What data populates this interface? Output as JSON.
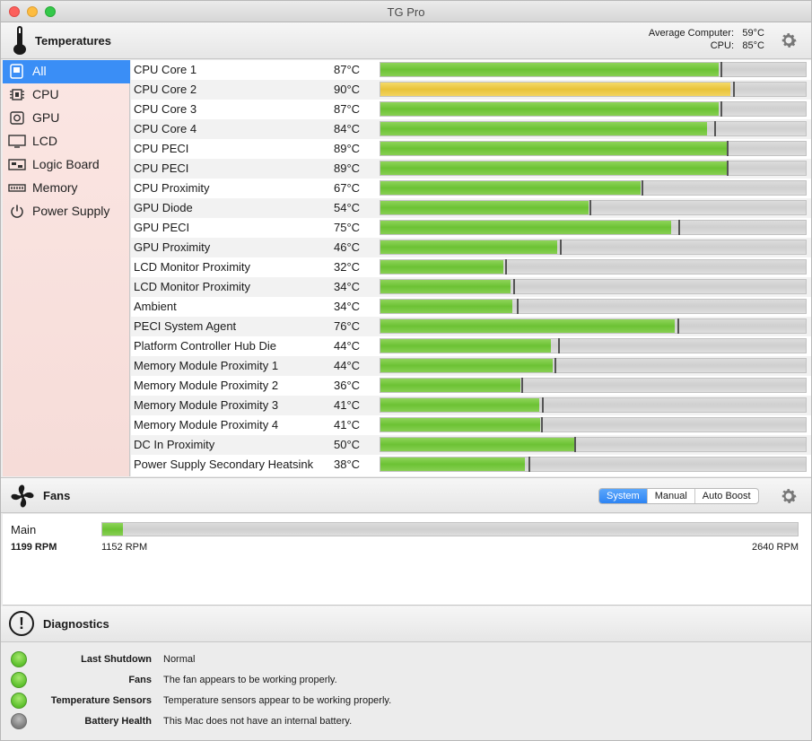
{
  "window": {
    "title": "TG Pro"
  },
  "temperatures": {
    "title": "Temperatures",
    "avg_label": "Average Computer:",
    "avg_value": "59°C",
    "cpu_label": "CPU:",
    "cpu_value": "85°C"
  },
  "sidebar": {
    "items": [
      {
        "label": "All",
        "icon": "all-icon",
        "active": true
      },
      {
        "label": "CPU",
        "icon": "cpu-icon",
        "active": false
      },
      {
        "label": "GPU",
        "icon": "gpu-icon",
        "active": false
      },
      {
        "label": "LCD",
        "icon": "lcd-icon",
        "active": false
      },
      {
        "label": "Logic Board",
        "icon": "logic-board-icon",
        "active": false
      },
      {
        "label": "Memory",
        "icon": "memory-icon",
        "active": false
      },
      {
        "label": "Power Supply",
        "icon": "power-icon",
        "active": false
      }
    ]
  },
  "sensors": [
    {
      "name": "CPU Core 1",
      "temp": "87°C",
      "level": 0.795,
      "max": 0.8,
      "warn": false
    },
    {
      "name": "CPU Core 2",
      "temp": "90°C",
      "level": 0.823,
      "max": 0.829,
      "warn": true
    },
    {
      "name": "CPU Core 3",
      "temp": "87°C",
      "level": 0.795,
      "max": 0.8,
      "warn": false
    },
    {
      "name": "CPU Core 4",
      "temp": "84°C",
      "level": 0.768,
      "max": 0.785,
      "warn": false
    },
    {
      "name": "CPU PECI",
      "temp": "89°C",
      "level": 0.814,
      "max": 0.815,
      "warn": false
    },
    {
      "name": "CPU PECI",
      "temp": "89°C",
      "level": 0.814,
      "max": 0.815,
      "warn": false
    },
    {
      "name": "CPU Proximity",
      "temp": "67°C",
      "level": 0.612,
      "max": 0.613,
      "warn": false
    },
    {
      "name": "GPU Diode",
      "temp": "54°C",
      "level": 0.49,
      "max": 0.491,
      "warn": false
    },
    {
      "name": "GPU PECI",
      "temp": "75°C",
      "level": 0.683,
      "max": 0.7,
      "warn": false
    },
    {
      "name": "GPU Proximity",
      "temp": "46°C",
      "level": 0.415,
      "max": 0.421,
      "warn": false
    },
    {
      "name": "LCD Monitor Proximity",
      "temp": "32°C",
      "level": 0.29,
      "max": 0.293,
      "warn": false
    },
    {
      "name": "LCD Monitor Proximity",
      "temp": "34°C",
      "level": 0.305,
      "max": 0.312,
      "warn": false
    },
    {
      "name": "Ambient",
      "temp": "34°C",
      "level": 0.31,
      "max": 0.32,
      "warn": false
    },
    {
      "name": "PECI System Agent",
      "temp": "76°C",
      "level": 0.692,
      "max": 0.699,
      "warn": false
    },
    {
      "name": "Platform Controller Hub Die",
      "temp": "44°C",
      "level": 0.4,
      "max": 0.418,
      "warn": false
    },
    {
      "name": "Memory Module Proximity 1",
      "temp": "44°C",
      "level": 0.405,
      "max": 0.41,
      "warn": false
    },
    {
      "name": "Memory Module Proximity 2",
      "temp": "36°C",
      "level": 0.33,
      "max": 0.332,
      "warn": false
    },
    {
      "name": "Memory Module Proximity 3",
      "temp": "41°C",
      "level": 0.373,
      "max": 0.38,
      "warn": false
    },
    {
      "name": "Memory Module Proximity 4",
      "temp": "41°C",
      "level": 0.375,
      "max": 0.378,
      "warn": false
    },
    {
      "name": "DC In Proximity",
      "temp": "50°C",
      "level": 0.455,
      "max": 0.456,
      "warn": false
    },
    {
      "name": "Power Supply Secondary Heatsink",
      "temp": "38°C",
      "level": 0.34,
      "max": 0.349,
      "warn": false
    }
  ],
  "fans": {
    "title": "Fans",
    "modes": [
      {
        "label": "System",
        "active": true
      },
      {
        "label": "Manual",
        "active": false
      },
      {
        "label": "Auto Boost",
        "active": false
      }
    ],
    "items": [
      {
        "name": "Main",
        "rpm": "1199 RPM",
        "min": "1152 RPM",
        "max": "2640 RPM",
        "min_rpm": 1152,
        "max_rpm": 2640,
        "current_rpm": 1199,
        "fill_fraction": 0.03
      }
    ]
  },
  "diagnostics": {
    "title": "Diagnostics",
    "items": [
      {
        "label": "Last Shutdown",
        "value": "Normal",
        "status": "green"
      },
      {
        "label": "Fans",
        "value": "The fan appears to be working properly.",
        "status": "green"
      },
      {
        "label": "Temperature Sensors",
        "value": "Temperature sensors appear to be working properly.",
        "status": "green"
      },
      {
        "label": "Battery Health",
        "value": "This Mac does not have an internal battery.",
        "status": "gray"
      }
    ]
  },
  "colors": {
    "accent": "#3a8ef6",
    "bar_green": "#6cc234",
    "bar_warn": "#e8c33a"
  }
}
